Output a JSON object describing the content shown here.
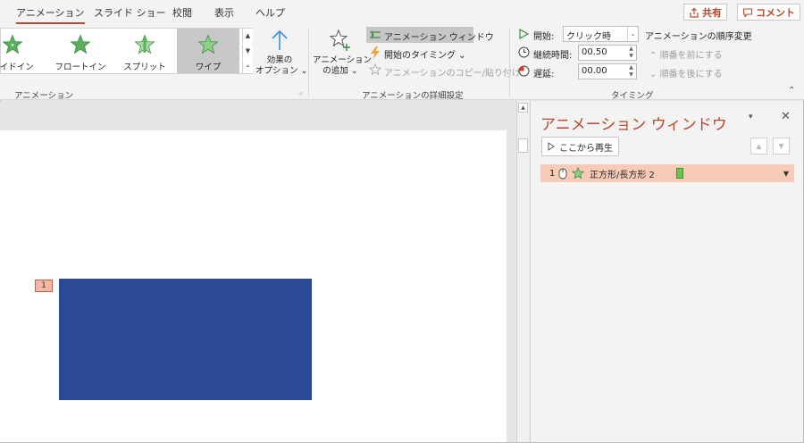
{
  "tabs": [
    {
      "label": "アニメーション",
      "active": true
    },
    {
      "label": "スライド ショー"
    },
    {
      "label": "校閲"
    },
    {
      "label": "表示"
    },
    {
      "label": "ヘルプ"
    }
  ],
  "top_buttons": {
    "share": "共有",
    "comment": "コメント"
  },
  "gallery": {
    "items": [
      {
        "label": "ライドイン",
        "icon": "slide-in-star-icon"
      },
      {
        "label": "フロートイン",
        "icon": "float-in-star-icon"
      },
      {
        "label": "スプリット",
        "icon": "split-star-icon"
      },
      {
        "label": "ワイプ",
        "icon": "wipe-star-icon",
        "selected": true
      }
    ]
  },
  "effect_options": {
    "line1": "効果の",
    "line2": "オプション ⌄"
  },
  "group_labels": {
    "animation": "アニメーション",
    "advanced": "アニメーションの詳細設定",
    "timing": "タイミング"
  },
  "advanced": {
    "add_line1": "アニメーション",
    "add_line2": "の追加 ⌄",
    "pane_button": "アニメーション ウィンドウ",
    "trigger": "開始のタイミング ⌄",
    "painter": "アニメーションのコピー/貼り付け"
  },
  "timing": {
    "start_label": "開始:",
    "start_value": "クリック時",
    "duration_label": "継続時間:",
    "duration_value": "00.50",
    "delay_label": "遅延:",
    "delay_value": "00.00",
    "reorder_title": "アニメーションの順序変更",
    "move_earlier": "順番を前にする",
    "move_later": "順番を後にする"
  },
  "slide": {
    "anim_tag": "1"
  },
  "pane": {
    "title": "アニメーション ウィンドウ",
    "play_button": "ここから再生",
    "items": [
      {
        "number": "1",
        "name": "正方形/長方形 2"
      }
    ]
  },
  "colors": {
    "accent": "#b7472a",
    "shape_fill": "#2b4a93",
    "selected_row": "#f7cbb7",
    "star_green": "#5bb05d",
    "anim_bar": "#6cc24a"
  }
}
